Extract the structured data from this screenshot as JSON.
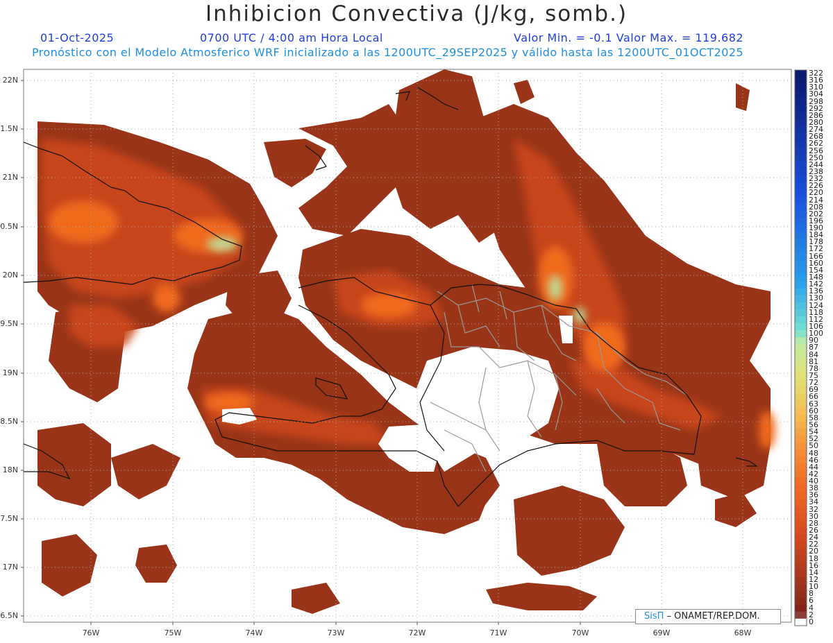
{
  "title": "Inhibicion Convectiva (J/kg, somb.)",
  "header": {
    "date": "01-Oct-2025",
    "time": "0700 UTC / 4:00 am Hora Local",
    "minmax": "Valor Min. = -0.1  Valor Max. = 119.682",
    "model_info": "Pronóstico con el Modelo Atmosferico WRF inicializado a las 1200UTC_29SEP2025 y válido hasta las  1200UTC_01OCT2025"
  },
  "axes": {
    "y_labels": [
      "22N",
      "1.5N",
      "21N",
      "0.5N",
      "20N",
      "9.5N",
      "19N",
      "8.5N",
      "18N",
      "7.5N",
      "17N",
      "6.5N"
    ],
    "x_labels": [
      "76W",
      "75W",
      "74W",
      "73W",
      "72W",
      "71W",
      "70W",
      "69W",
      "68W"
    ]
  },
  "colorbar": {
    "labels": [
      "322",
      "316",
      "310",
      "304",
      "298",
      "292",
      "286",
      "280",
      "274",
      "268",
      "262",
      "256",
      "250",
      "244",
      "238",
      "232",
      "226",
      "220",
      "214",
      "208",
      "202",
      "196",
      "190",
      "184",
      "178",
      "172",
      "166",
      "160",
      "154",
      "148",
      "142",
      "136",
      "130",
      "124",
      "118",
      "112",
      "106",
      "100",
      "90",
      "87",
      "84",
      "81",
      "78",
      "75",
      "72",
      "69",
      "66",
      "63",
      "60",
      "58",
      "56",
      "54",
      "52",
      "50",
      "48",
      "46",
      "44",
      "42",
      "40",
      "38",
      "36",
      "34",
      "32",
      "30",
      "28",
      "26",
      "24",
      "22",
      "20",
      "18",
      "16",
      "14",
      "12",
      "10",
      "8",
      "6",
      "4",
      "2",
      "0"
    ]
  },
  "credit": {
    "brand": "SisΠ",
    "text": " – ONAMET/REP.DOM."
  },
  "colors": {
    "field_dark": "#9a3418",
    "field_mid": "#d1521e",
    "field_hot": "#f06a1c",
    "field_peak": "#b9e9a8",
    "border": "#101010",
    "provinces": "#9a9a9a"
  }
}
